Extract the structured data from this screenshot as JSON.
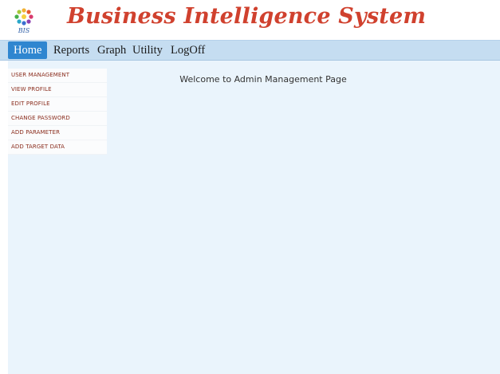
{
  "header": {
    "logo_icon": "bis-logo-icon",
    "logo_text": "BIS",
    "title": "Business Intelligence System"
  },
  "nav": {
    "items": [
      {
        "label": "Home",
        "active": true
      },
      {
        "label": "Reports",
        "active": false
      },
      {
        "label": "Graph",
        "active": false
      },
      {
        "label": "Utility",
        "active": false
      },
      {
        "label": "LogOff",
        "active": false
      }
    ]
  },
  "sidebar": {
    "items": [
      {
        "label": "USER MANAGEMENT"
      },
      {
        "label": "VIEW PROFILE"
      },
      {
        "label": "EDIT PROFILE"
      },
      {
        "label": "CHANGE PASSWORD"
      },
      {
        "label": "ADD PARAMETER"
      },
      {
        "label": "ADD TARGET DATA"
      }
    ]
  },
  "main": {
    "welcome_text": "Welcome to Admin Management Page"
  },
  "colors": {
    "brand": "#d0412e",
    "nav_bar": "#c5ddf1",
    "nav_active": "#2f86d0",
    "content_bg": "#eaf4fc",
    "sidebar_link": "#8a2c1c"
  }
}
